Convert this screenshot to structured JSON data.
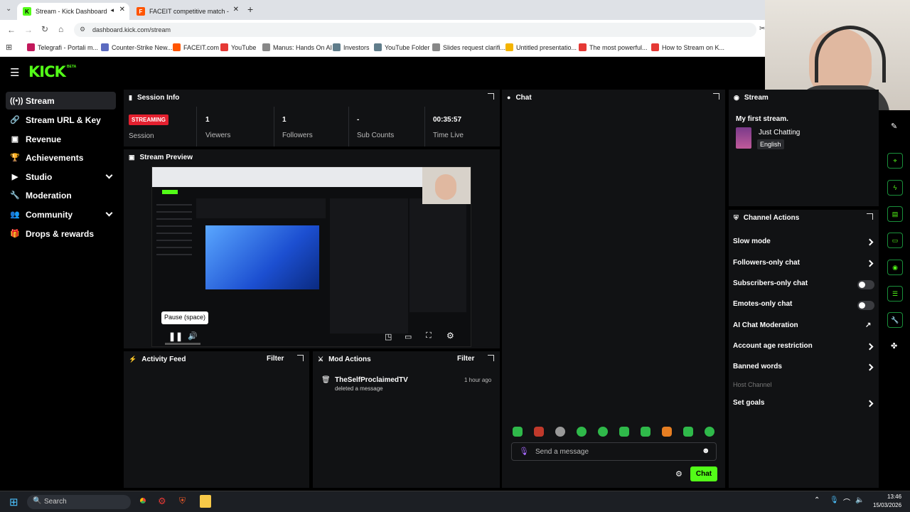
{
  "browser": {
    "tabs": [
      {
        "label": "Stream - Kick Dashboard",
        "active": true
      },
      {
        "label": "FACEIT competitive match - FACE",
        "active": false
      }
    ],
    "new_tab": "+",
    "url": "dashboard.kick.com/stream",
    "bookmarks": [
      "Telegrafi - Portali m...",
      "Counter-Strike New...",
      "FACEIT.com",
      "YouTube",
      "Manus: Hands On AI",
      "Investors",
      "YouTube Folder",
      "Slides request clarifi...",
      "Untitled presentatio...",
      "The most powerful...",
      "How to Stream on K..."
    ]
  },
  "app": {
    "logo": "KICK",
    "logo_badge": "BETA"
  },
  "sidebar": {
    "items": [
      {
        "label": "Stream",
        "icon": "broadcast-icon",
        "glyph": "((•))",
        "selected": true,
        "expandable": false
      },
      {
        "label": "Stream URL & Key",
        "icon": "link-icon",
        "glyph": "🔗",
        "selected": false,
        "expandable": false
      },
      {
        "label": "Revenue",
        "icon": "wallet-icon",
        "glyph": "▣",
        "selected": false,
        "expandable": false
      },
      {
        "label": "Achievements",
        "icon": "trophy-icon",
        "glyph": "🏆",
        "selected": false,
        "expandable": false
      },
      {
        "label": "Studio",
        "icon": "video-icon",
        "glyph": "▶",
        "selected": false,
        "expandable": true
      },
      {
        "label": "Moderation",
        "icon": "wrench-icon",
        "glyph": "🔧",
        "selected": false,
        "expandable": false
      },
      {
        "label": "Community",
        "icon": "people-icon",
        "glyph": "👥",
        "selected": false,
        "expandable": true
      },
      {
        "label": "Drops & rewards",
        "icon": "gift-icon",
        "glyph": "🎁",
        "selected": false,
        "expandable": false
      }
    ]
  },
  "session": {
    "title": "Session Info",
    "status_badge": "STREAMING",
    "status_label": "Session",
    "stats": [
      {
        "value": "1",
        "label": "Viewers"
      },
      {
        "value": "1",
        "label": "Followers"
      },
      {
        "value": "-",
        "label": "Sub Counts"
      },
      {
        "value": "00:35:57",
        "label": "Time Live"
      }
    ]
  },
  "preview": {
    "title": "Stream Preview",
    "tooltip": "Pause (space)"
  },
  "activity": {
    "title": "Activity Feed",
    "filter": "Filter"
  },
  "mod_actions": {
    "title": "Mod Actions",
    "filter": "Filter",
    "items": [
      {
        "user": "TheSelfProclaimedTV",
        "action": "deleted a message",
        "time": "1 hour ago"
      }
    ]
  },
  "chat": {
    "title": "Chat",
    "placeholder": "Send a message",
    "send_label": "Chat"
  },
  "stream_info": {
    "title": "Stream",
    "stream_title": "My first stream.",
    "category": "Just Chatting",
    "language": "English"
  },
  "channel_actions": {
    "title": "Channel Actions",
    "items": [
      {
        "label": "Slow mode",
        "control": "arrow",
        "enabled": true
      },
      {
        "label": "Followers-only chat",
        "control": "arrow",
        "enabled": true
      },
      {
        "label": "Subscribers-only chat",
        "control": "toggle",
        "enabled": true
      },
      {
        "label": "Emotes-only chat",
        "control": "toggle",
        "enabled": true
      },
      {
        "label": "AI Chat Moderation",
        "control": "external",
        "enabled": true
      },
      {
        "label": "Account age restriction",
        "control": "arrow",
        "enabled": true
      },
      {
        "label": "Banned words",
        "control": "arrow",
        "enabled": true
      },
      {
        "label": "Host Channel",
        "control": "none",
        "enabled": false
      },
      {
        "label": "Set goals",
        "control": "arrow",
        "enabled": true
      }
    ]
  },
  "taskbar": {
    "search_placeholder": "Search",
    "time": "13:46",
    "date": "15/03/2026"
  },
  "colors": {
    "accent": "#53fc18",
    "streaming_badge": "#e4202f",
    "panel": "#111214"
  }
}
